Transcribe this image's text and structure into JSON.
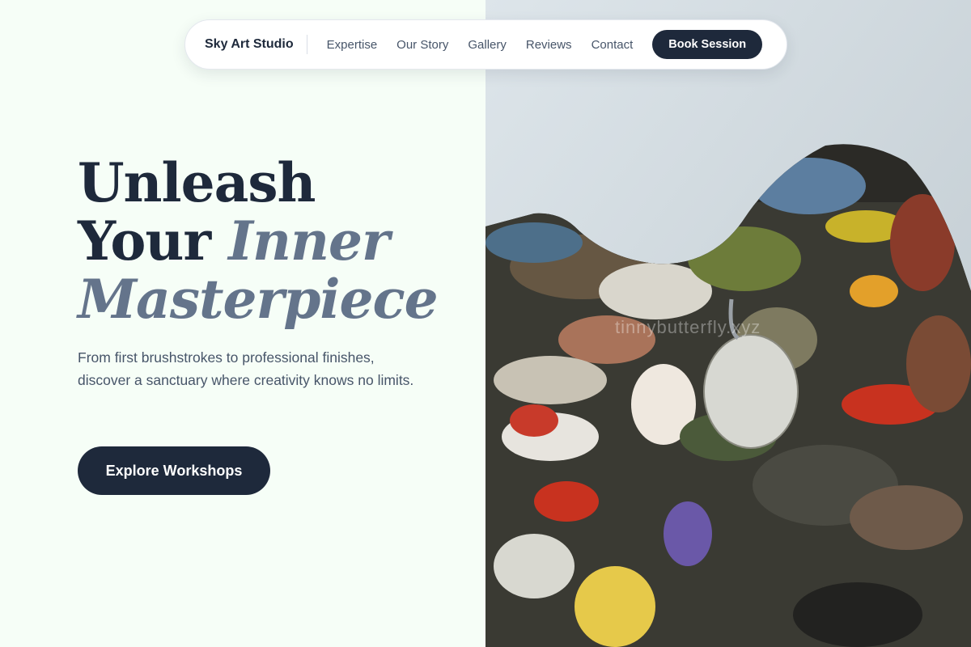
{
  "nav": {
    "brand": "Sky Art Studio",
    "links": [
      "Expertise",
      "Our Story",
      "Gallery",
      "Reviews",
      "Contact"
    ],
    "cta": "Book Session"
  },
  "hero": {
    "title_line1": "Unleash",
    "title_line2_plain": "Your ",
    "title_line2_accent": "Inner",
    "title_line3_accent": "Masterpiece",
    "subtitle": "From first brushstrokes to professional finishes, discover a sanctuary where creativity knows no limits.",
    "cta": "Explore Workshops"
  },
  "image": {
    "subject": "paint-palette-photo",
    "watermark": "tinnybutterfly.xyz"
  },
  "colors": {
    "primary": "#1e293b",
    "accent": "#64748b",
    "background": "#f6fef7"
  }
}
